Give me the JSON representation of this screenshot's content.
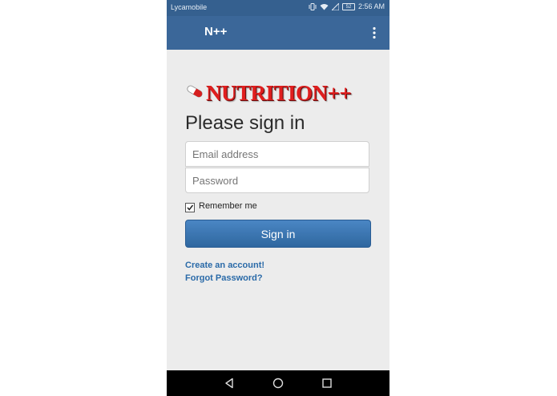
{
  "status_bar": {
    "carrier": "Lycamobile",
    "time": "2:56 AM",
    "battery": "52"
  },
  "app_bar": {
    "title": "N++"
  },
  "logo": {
    "text": "NUTRITION++"
  },
  "heading": "Please sign in",
  "form": {
    "email_placeholder": "Email address",
    "password_placeholder": "Password",
    "remember_label": "Remember me",
    "remember_checked": true,
    "signin_label": "Sign in"
  },
  "links": {
    "create_account": "Create an account!",
    "forgot_password": "Forgot Password?"
  },
  "colors": {
    "status_bar": "#35608f",
    "app_bar": "#3b6799",
    "button": "#3a73b0",
    "link": "#2a6aa8",
    "logo_red": "#e01e1e"
  }
}
